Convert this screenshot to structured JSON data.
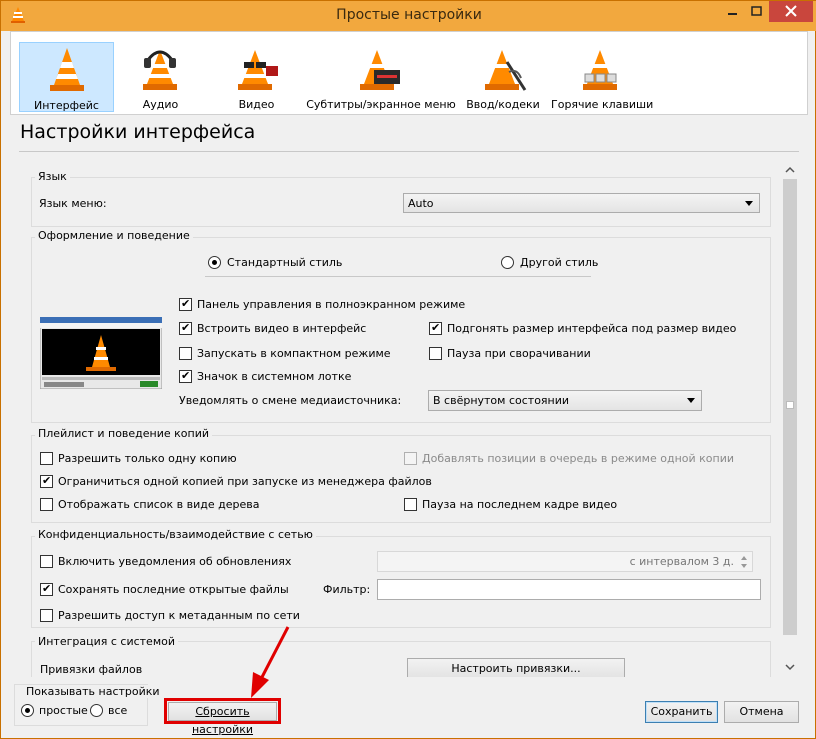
{
  "window": {
    "title": "Простые настройки",
    "minimize_label": "",
    "colors": {
      "titlebar": "#f2a83e",
      "close": "#c9463d",
      "accent": "#e00000"
    }
  },
  "categories": [
    {
      "label": "Интерфейс",
      "icon": "interface-cone-icon",
      "selected": true
    },
    {
      "label": "Аудио",
      "icon": "audio-cone-headphones-icon",
      "selected": false
    },
    {
      "label": "Видео",
      "icon": "video-cone-glasses-icon",
      "selected": false
    },
    {
      "label": "Субтитры/экранное меню",
      "icon": "subtitles-cone-icon",
      "selected": false
    },
    {
      "label": "Ввод/кодеки",
      "icon": "codecs-cone-icon",
      "selected": false
    },
    {
      "label": "Горячие клавиши",
      "icon": "hotkeys-cone-icon",
      "selected": false
    }
  ],
  "heading": "Настройки интерфейса",
  "language": {
    "group_title": "Язык",
    "menu_language_label": "Язык меню:",
    "menu_language_value": "Auto"
  },
  "look": {
    "group_title": "Оформление и поведение",
    "style_standard": "Стандартный стиль",
    "style_other": "Другой стиль",
    "fullscreen_controls": "Панель управления в полноэкранном режиме",
    "embed_video": "Встроить видео в интерфейс",
    "resize_interface": "Подгонять размер интерфейса под размер видео",
    "compact_mode": "Запускать в компактном режиме",
    "pause_minimize": "Пауза при сворачивании",
    "systray_icon": "Значок в системном лотке",
    "notify_label": "Уведомлять о смене медиаисточника:",
    "notify_value": "В свёрнутом состоянии"
  },
  "playlist": {
    "group_title": "Плейлист и поведение копий",
    "one_instance": "Разрешить только одну копию",
    "enqueue_one": "Добавлять позиции в очередь в режиме одной копии",
    "one_instance_file_manager": "Ограничиться одной копией при запуске из менеджера файлов",
    "tree_view": "Отображать список в виде дерева",
    "pause_last_frame": "Пауза на последнем кадре видео"
  },
  "privacy": {
    "group_title": "Конфиденциальность/взаимодействие с сетью",
    "update_notify": "Включить уведомления об обновлениях",
    "interval_value": "с интервалом 3 д.",
    "save_recent": "Сохранять последние открытые файлы",
    "filter_label": "Фильтр:",
    "filter_value": "",
    "metadata_access": "Разрешить доступ к метаданным по сети"
  },
  "integration": {
    "group_title": "Интеграция с системой",
    "file_assoc_label": "Привязки файлов",
    "file_assoc_button": "Настроить привязки..."
  },
  "footer": {
    "show_settings_label": "Показывать настройки",
    "simple": "простые",
    "all": "все",
    "reset_button": "Сбросить настройки",
    "save_button": "Сохранить",
    "cancel_button": "Отмена"
  }
}
